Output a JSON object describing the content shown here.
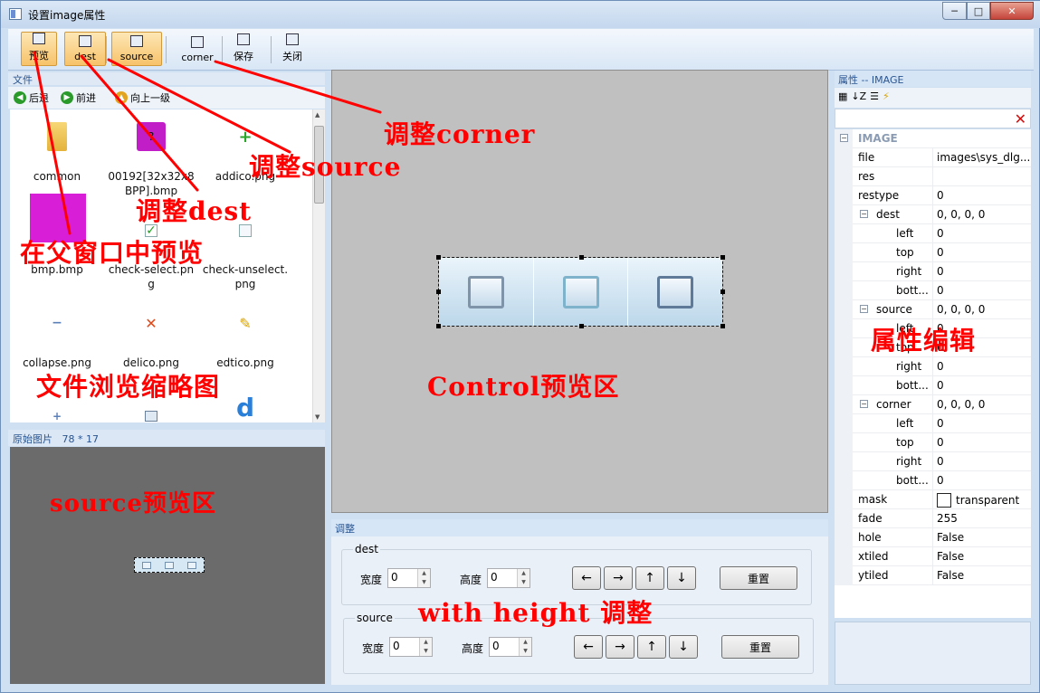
{
  "window": {
    "title": "设置image属性",
    "min": "─",
    "max": "□",
    "close": "✕"
  },
  "toolbar": [
    {
      "label": "预览",
      "icon": "preview-icon",
      "active": true
    },
    {
      "label": "dest",
      "icon": "dest-icon",
      "active": true
    },
    {
      "label": "source",
      "icon": "source-icon",
      "active": true
    },
    {
      "label": "corner",
      "icon": "corner-icon",
      "active": false
    },
    {
      "label": "保存",
      "icon": "save-icon",
      "active": false
    },
    {
      "label": "关闭",
      "icon": "close-doc-icon",
      "active": false
    }
  ],
  "files": {
    "header": "文件",
    "nav": {
      "back": "后退",
      "forward": "前进",
      "up": "向上一级"
    },
    "items": [
      {
        "name": "common",
        "icon": "folder-icon"
      },
      {
        "name": "00192[32x32x8BPP].bmp",
        "icon": "help-icon"
      },
      {
        "name": "addico.png",
        "icon": "plus-icon"
      },
      {
        "name": "bmp.bmp",
        "icon": "bmp-icon"
      },
      {
        "name": "check-select.png",
        "icon": "checkbox-checked-icon"
      },
      {
        "name": "check-unselect.png",
        "icon": "checkbox-empty-icon"
      },
      {
        "name": "collapse.png",
        "icon": "minus-icon"
      },
      {
        "name": "delico.png",
        "icon": "delete-x-icon"
      },
      {
        "name": "edtico.png",
        "icon": "pencil-icon"
      },
      {
        "name": "",
        "icon": "plus-small-icon"
      },
      {
        "name": "",
        "icon": "window-icon"
      },
      {
        "name": "",
        "icon": "dj-logo-icon"
      }
    ]
  },
  "original": {
    "label": "原始图片",
    "size": "78 * 17"
  },
  "adjust": {
    "header": "调整",
    "groups": [
      {
        "title": "dest",
        "width_label": "宽度",
        "width": "0",
        "height_label": "高度",
        "height": "0",
        "reset": "重置"
      },
      {
        "title": "source",
        "width_label": "宽度",
        "width": "0",
        "height_label": "高度",
        "height": "0",
        "reset": "重置"
      }
    ],
    "arrows": [
      "←",
      "→",
      "↑",
      "↓"
    ]
  },
  "properties": {
    "header": "属性 -- IMAGE",
    "clear": "✕",
    "rows": [
      {
        "key": "IMAGE",
        "value": "",
        "level": 0,
        "category": true,
        "toggle": "⊟"
      },
      {
        "key": "file",
        "value": "images\\sys_dlg...",
        "level": 1
      },
      {
        "key": "res",
        "value": "",
        "level": 1
      },
      {
        "key": "restype",
        "value": "0",
        "level": 1
      },
      {
        "key": "dest",
        "value": "0, 0, 0, 0",
        "level": 1,
        "toggle": "⊟"
      },
      {
        "key": "left",
        "value": "0",
        "level": 2
      },
      {
        "key": "top",
        "value": "0",
        "level": 2
      },
      {
        "key": "right",
        "value": "0",
        "level": 2
      },
      {
        "key": "bott...",
        "value": "0",
        "level": 2
      },
      {
        "key": "source",
        "value": "0, 0, 0, 0",
        "level": 1,
        "toggle": "⊟"
      },
      {
        "key": "left",
        "value": "0",
        "level": 2
      },
      {
        "key": "top",
        "value": "0",
        "level": 2
      },
      {
        "key": "right",
        "value": "0",
        "level": 2
      },
      {
        "key": "bott...",
        "value": "0",
        "level": 2
      },
      {
        "key": "corner",
        "value": "0, 0, 0, 0",
        "level": 1,
        "toggle": "⊟"
      },
      {
        "key": "left",
        "value": "0",
        "level": 2
      },
      {
        "key": "top",
        "value": "0",
        "level": 2
      },
      {
        "key": "right",
        "value": "0",
        "level": 2
      },
      {
        "key": "bott...",
        "value": "0",
        "level": 2
      },
      {
        "key": "mask",
        "value": "transparent",
        "level": 1,
        "swatch": true
      },
      {
        "key": "fade",
        "value": "255",
        "level": 1
      },
      {
        "key": "hole",
        "value": "False",
        "level": 1
      },
      {
        "key": "xtiled",
        "value": "False",
        "level": 1
      },
      {
        "key": "ytiled",
        "value": "False",
        "level": 1
      }
    ]
  },
  "annotations": {
    "preview": "在父窗口中预览",
    "dest": "调整dest",
    "source": "调整source",
    "corner": "调整corner",
    "files": "文件浏览缩略图",
    "source_preview": "source预览区",
    "control_preview": "Control预览区",
    "props": "属性编辑",
    "wh": "with height 调整"
  },
  "colors": {
    "annotation": "#ff0000",
    "toolbar_active": "#f7c36a",
    "panel_header": "#2a5590"
  }
}
